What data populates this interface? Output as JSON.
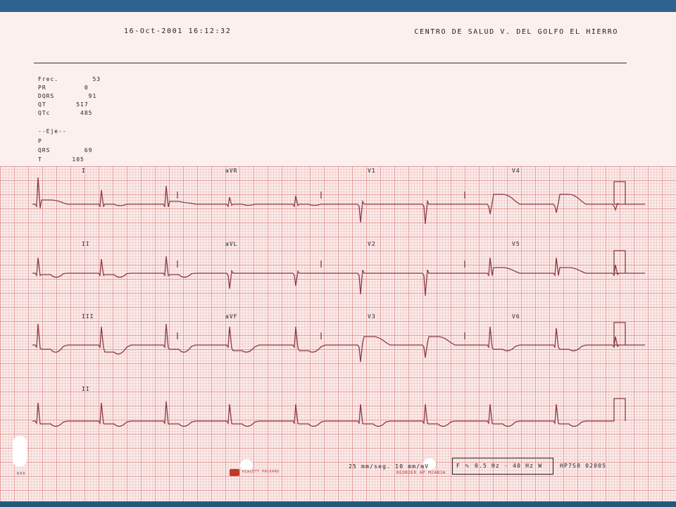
{
  "header": {
    "datetime": "16-Oct-2001   16:12:32",
    "center": "CENTRO DE SALUD V. DEL GOLFO  EL HIERRO"
  },
  "measurements": [
    {
      "label": "Frec.",
      "value": "53"
    },
    {
      "label": "PR",
      "value": "0"
    },
    {
      "label": "DQRS",
      "value": "91"
    },
    {
      "label": "QT",
      "value": "517"
    },
    {
      "label": "QTc",
      "value": "485"
    }
  ],
  "axis": {
    "title": "--Eje--",
    "items": [
      {
        "label": "P",
        "value": ""
      },
      {
        "label": "QRS",
        "value": "69"
      },
      {
        "label": "T",
        "value": "105"
      }
    ]
  },
  "leads": {
    "row1": [
      "I",
      "aVR",
      "V1",
      "V4"
    ],
    "row2": [
      "II",
      "aVL",
      "V2",
      "V5"
    ],
    "row3": [
      "III",
      "aVF",
      "V3",
      "V6"
    ],
    "row4": [
      "II"
    ]
  },
  "footer": {
    "speed": "25 mm/seg.   10 mm/mV",
    "filter": "F ∿ 0.5 Hz - 40 Hz W",
    "device": "HP7S8   02005",
    "reorder": "REORDER HP M2483A",
    "brand": "HEWLETT PACKARD",
    "page": "800"
  },
  "colors": {
    "trace": "#8a3b47",
    "grid": "#d77878",
    "paper": "#fbf0ee",
    "top_bar": "#2e6390"
  }
}
